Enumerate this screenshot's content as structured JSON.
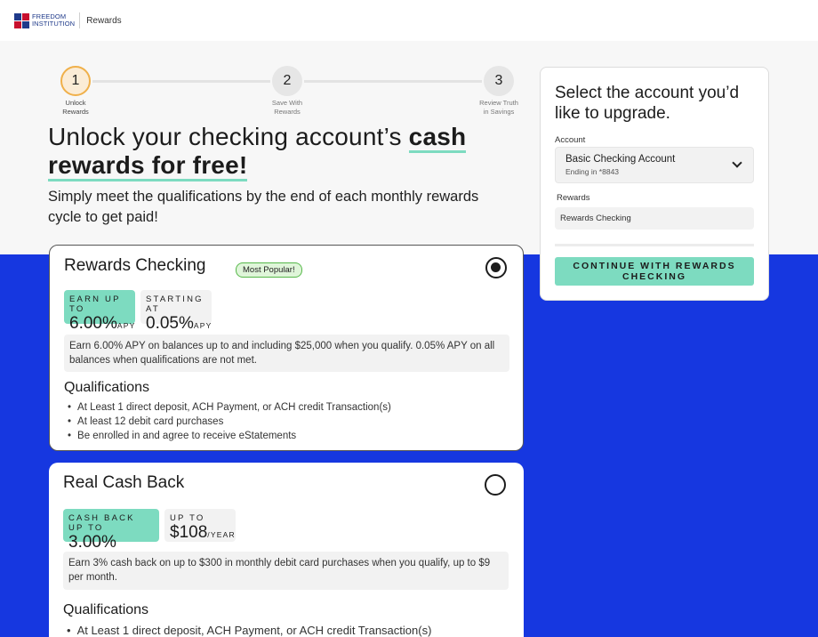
{
  "header": {
    "logo_line1": "FREEDOM",
    "logo_line2": "INSTITUTION",
    "section": "Rewards"
  },
  "stepper": {
    "steps": [
      {
        "number": "1",
        "label_line1": "Unlock",
        "label_line2": "Rewards"
      },
      {
        "number": "2",
        "label_line1": "Save With",
        "label_line2": "Rewards"
      },
      {
        "number": "3",
        "label_line1": "Review Truth",
        "label_line2": "in Savings"
      }
    ]
  },
  "hero": {
    "title_regular": "Unlock your checking account’s ",
    "title_bold_1": "cash",
    "title_bold_2": "rewards for free!",
    "subtitle": "Simply meet the qualifications by the end of each monthly rewards cycle to get paid!"
  },
  "cards": [
    {
      "title": "Rewards Checking",
      "badge": "Most Popular!",
      "selected": true,
      "rate1_label": "EARN UP TO",
      "rate1_value": "6.00%",
      "rate1_suffix": "APY",
      "rate2_label": "STARTING AT",
      "rate2_value": "0.05%",
      "rate2_suffix": "APY",
      "description": "Earn 6.00% APY on balances up to and including $25,000 when you qualify. 0.05% APY on all balances when qualifications are not met.",
      "qualifications_title": "Qualifications",
      "qualifications": [
        "At Least 1 direct deposit, ACH Payment, or ACH credit Transaction(s)",
        "At least 12 debit card purchases",
        "Be enrolled in and agree to receive eStatements"
      ]
    },
    {
      "title": "Real Cash Back",
      "selected": false,
      "rate1_label": "CASH BACK UP TO",
      "rate1_value": "3.00%",
      "rate2_label": "UP TO",
      "rate2_value": "$108",
      "rate2_suffix": "/YEAR",
      "description": "Earn 3% cash back on up to $300 in monthly debit card purchases when you qualify, up to $9 per month.",
      "qualifications_title": "Qualifications",
      "qualifications": [
        "At Least 1 direct deposit, ACH Payment, or ACH credit Transaction(s)"
      ]
    }
  ],
  "panel": {
    "title": "Select the account you’d like to upgrade.",
    "account_label": "Account",
    "account_value": "Basic Checking Account",
    "account_sub": "Ending in *8843",
    "rewards_label": "Rewards",
    "rewards_value": "Rewards Checking",
    "cta_label": "CONTINUE WITH REWARDS CHECKING"
  },
  "colors": {
    "accent_green": "#7ddbc0",
    "brand_blue": "#1637e0",
    "step_active": "#f0b04a"
  }
}
